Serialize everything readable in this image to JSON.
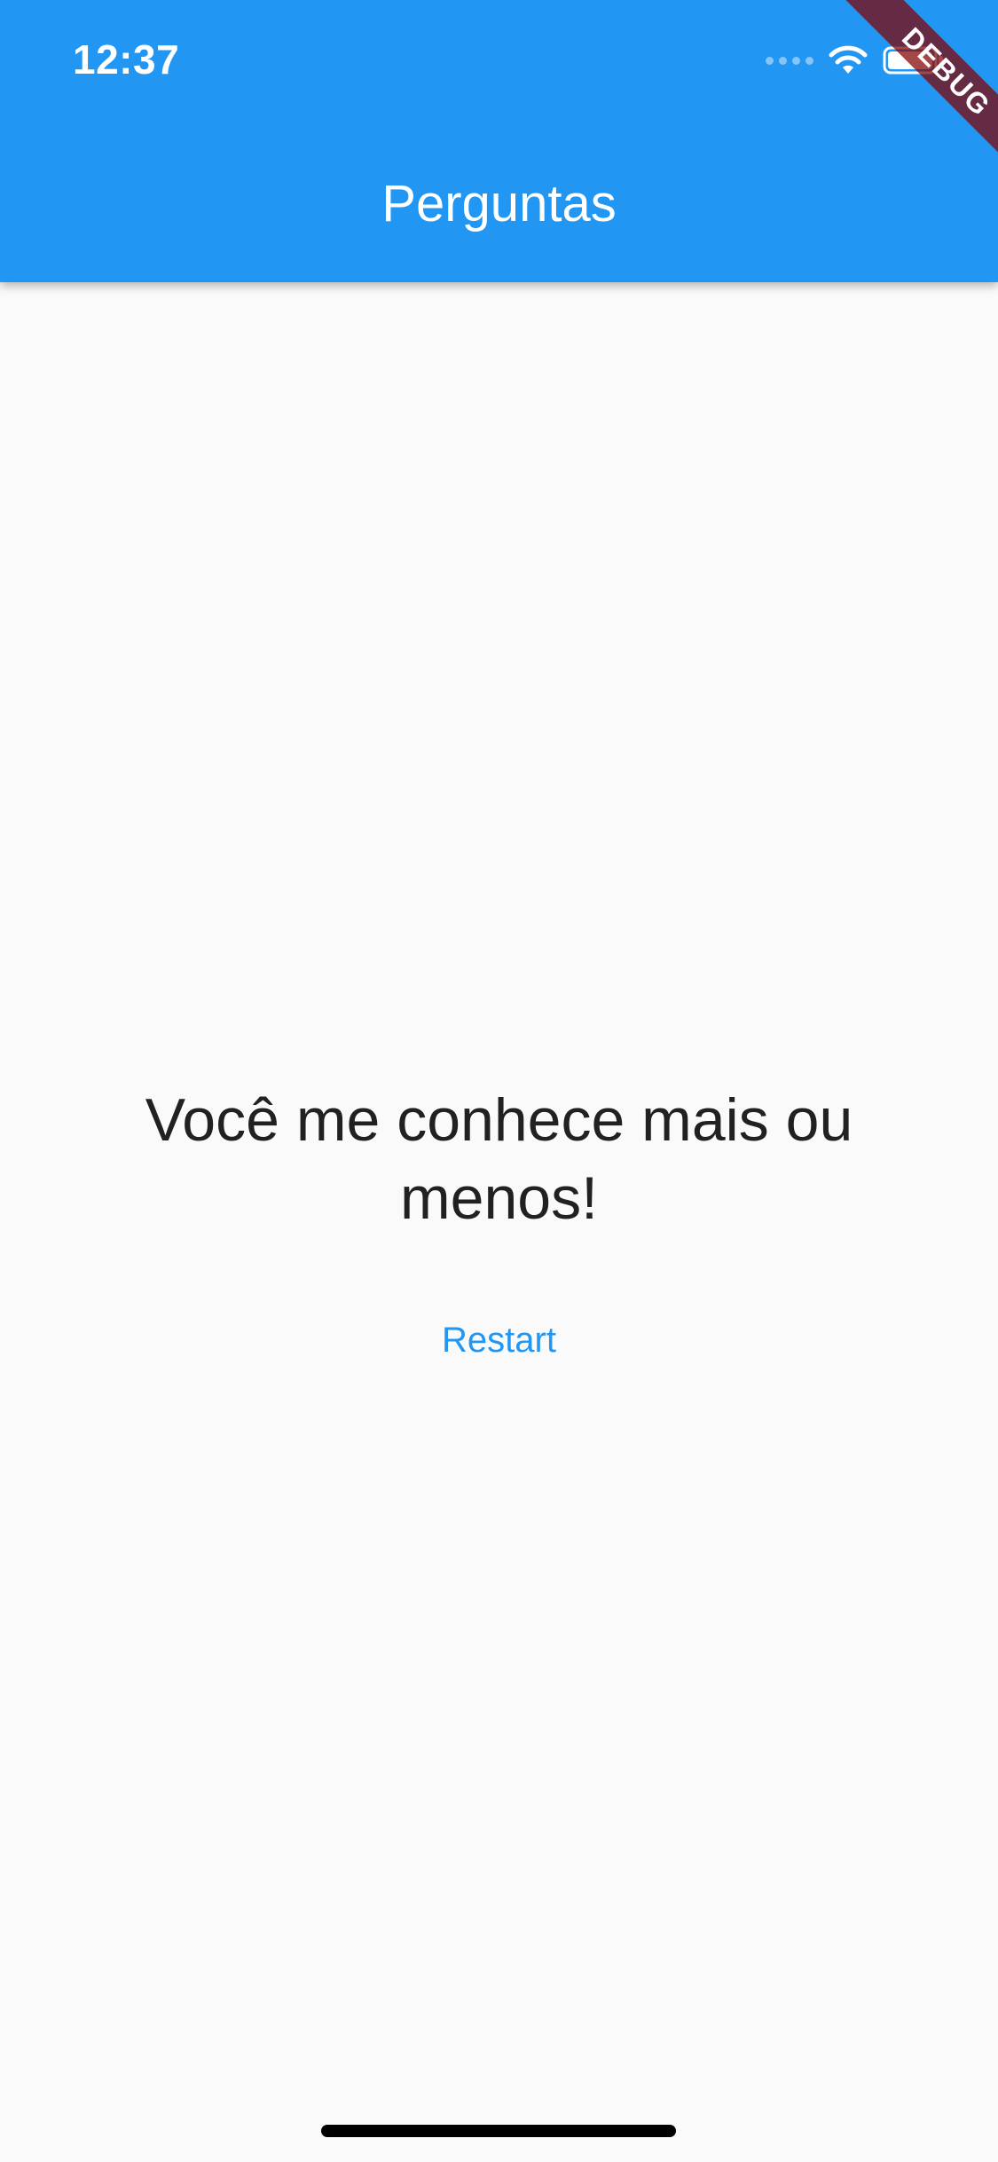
{
  "status_bar": {
    "time": "12:37",
    "icons": [
      "signal-dots-icon",
      "wifi-icon",
      "battery-icon"
    ]
  },
  "app_bar": {
    "title": "Perguntas",
    "background_color": "#2196f3"
  },
  "debug_banner": {
    "label": "DEBUG"
  },
  "result": {
    "message": "Você me conhece mais ou menos!",
    "restart_label": "Restart",
    "accent_color": "#2196f3"
  }
}
